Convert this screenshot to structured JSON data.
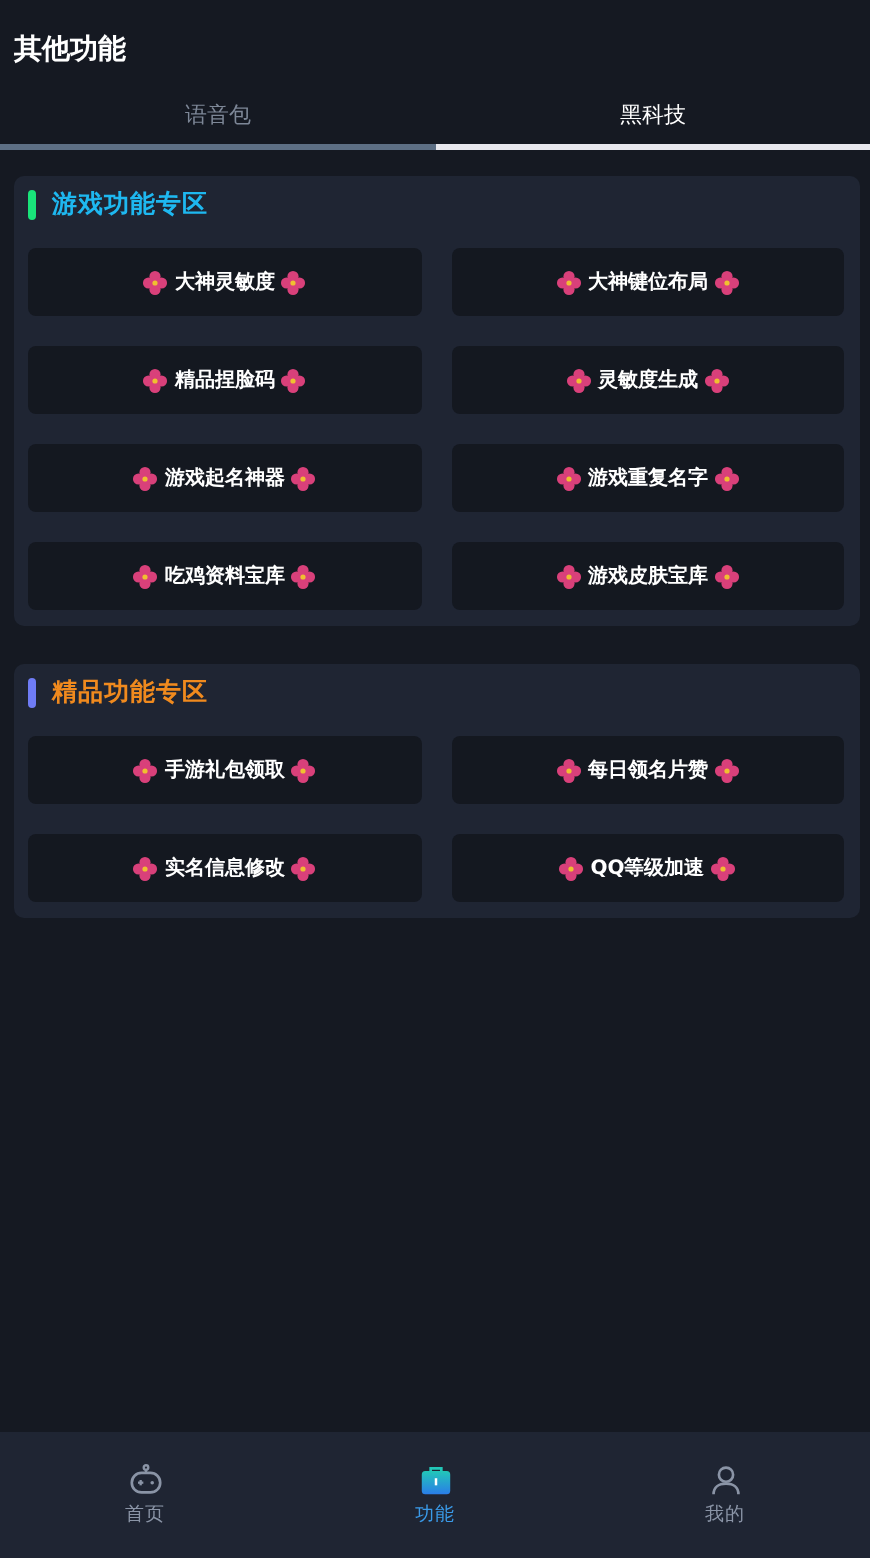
{
  "header": {
    "title": "其他功能"
  },
  "tabs": [
    {
      "label": "语音包",
      "selected": false
    },
    {
      "label": "黑科技",
      "selected": true
    }
  ],
  "sections": [
    {
      "title": "游戏功能专区",
      "kind": "cyan",
      "color": "#19e37a",
      "items": [
        "大神灵敏度",
        "大神键位布局",
        "精品捏脸码",
        "灵敏度生成",
        "游戏起名神器",
        "游戏重复名字",
        "吃鸡资料宝库",
        "游戏皮肤宝库"
      ]
    },
    {
      "title": "精品功能专区",
      "kind": "orange",
      "color": "#6f7cf5",
      "items": [
        "手游礼包领取",
        "每日领名片赞",
        "实名信息修改",
        "QQ等级加速"
      ]
    }
  ],
  "nav": [
    {
      "label": "首页",
      "kind": "robot",
      "selected": false
    },
    {
      "label": "功能",
      "kind": "bag",
      "selected": true
    },
    {
      "label": "我的",
      "kind": "person",
      "selected": false
    }
  ]
}
